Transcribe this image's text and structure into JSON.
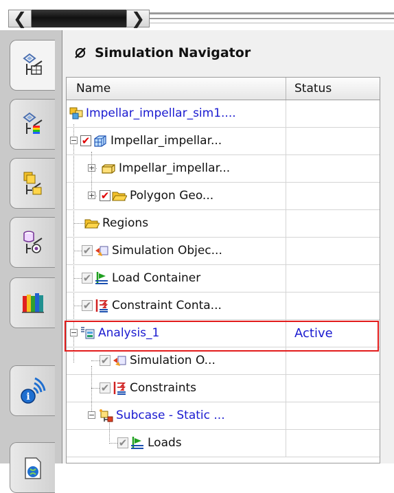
{
  "navigator": {
    "title": "Simulation Navigator",
    "title_icon": "navigator-icon"
  },
  "columns": {
    "name": "Name",
    "status": "Status"
  },
  "rows": [
    {
      "label": "Impellar_impellar_sim1....",
      "status": "",
      "icon": "simfile-icon",
      "checkbox": "none",
      "color": "blue"
    },
    {
      "label": "Impellar_impellar...",
      "status": "",
      "icon": "fem-mesh-icon",
      "checkbox": "checked-red",
      "color": "black"
    },
    {
      "label": "Impellar_impellar...",
      "status": "",
      "icon": "part-icon",
      "checkbox": "none",
      "color": "black"
    },
    {
      "label": "Polygon Geo...",
      "status": "",
      "icon": "folder-icon",
      "checkbox": "checked-red",
      "color": "black"
    },
    {
      "label": "Regions",
      "status": "",
      "icon": "folder-icon",
      "checkbox": "none",
      "color": "black"
    },
    {
      "label": "Simulation Objec...",
      "status": "",
      "icon": "simulation-object-icon",
      "checkbox": "checked-grey",
      "color": "black"
    },
    {
      "label": "Load Container",
      "status": "",
      "icon": "load-icon",
      "checkbox": "checked-grey",
      "color": "black"
    },
    {
      "label": "Constraint Conta...",
      "status": "",
      "icon": "constraint-icon",
      "checkbox": "checked-grey",
      "color": "black"
    },
    {
      "label": "Analysis_1",
      "status": "Active",
      "icon": "solution-icon",
      "checkbox": "none",
      "color": "blue"
    },
    {
      "label": "Simulation O...",
      "status": "",
      "icon": "simulation-object-icon",
      "checkbox": "checked-grey",
      "color": "black"
    },
    {
      "label": "Constraints",
      "status": "",
      "icon": "constraint-icon",
      "checkbox": "checked-grey",
      "color": "black"
    },
    {
      "label": "Subcase - Static ...",
      "status": "",
      "icon": "subcase-icon",
      "checkbox": "none",
      "color": "blue"
    },
    {
      "label": "Loads",
      "status": "",
      "icon": "load-icon",
      "checkbox": "checked-grey",
      "color": "black"
    }
  ],
  "resource_tabs": [
    {
      "icon": "simulation-navigator-tab-icon",
      "active": true
    },
    {
      "icon": "post-processing-navigator-tab-icon",
      "active": false
    },
    {
      "icon": "assembly-navigator-tab-icon",
      "active": false
    },
    {
      "icon": "constraint-navigator-tab-icon",
      "active": false
    },
    {
      "icon": "reuse-library-tab-icon",
      "active": false
    },
    {
      "icon": "roles-tab-icon",
      "active": false
    },
    {
      "icon": "web-browser-tab-icon",
      "active": false
    }
  ],
  "colors": {
    "highlight": "#e21b1b",
    "active_text": "#1a1ad0"
  }
}
